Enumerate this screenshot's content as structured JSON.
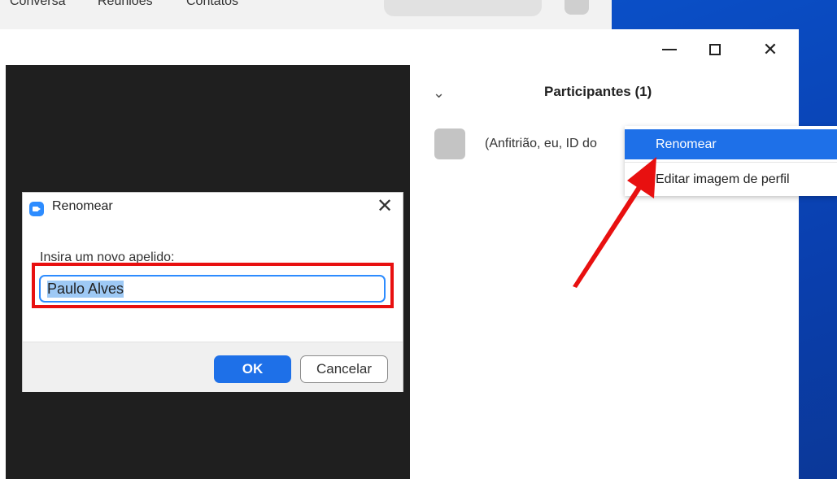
{
  "top_tabs": [
    {
      "label": "Conversa"
    },
    {
      "label": "Reuniões"
    },
    {
      "label": "Contatos"
    }
  ],
  "window_controls": {
    "minimize_icon": "minimize-icon",
    "maximize_icon": "maximize-icon",
    "close_glyph": "✕"
  },
  "participants_panel": {
    "collapse_glyph": "⌄",
    "title": "Participantes (1)",
    "participant_name": "(Anfitrião, eu, ID do"
  },
  "context_menu": {
    "items": [
      {
        "label": "Renomear",
        "active": true
      },
      {
        "label": "Editar imagem de perfil",
        "active": false
      }
    ]
  },
  "rename_dialog": {
    "title": "Renomear",
    "close_glyph": "✕",
    "prompt_label": "Insira um novo apelido:",
    "input_value": "Paulo Alves",
    "ok_label": "OK",
    "cancel_label": "Cancelar"
  },
  "colors": {
    "accent_blue": "#1e70e8",
    "annotation_red": "#e81010",
    "desktop_blue": "#0a4fc7",
    "video_bg": "#1f1f1f"
  }
}
